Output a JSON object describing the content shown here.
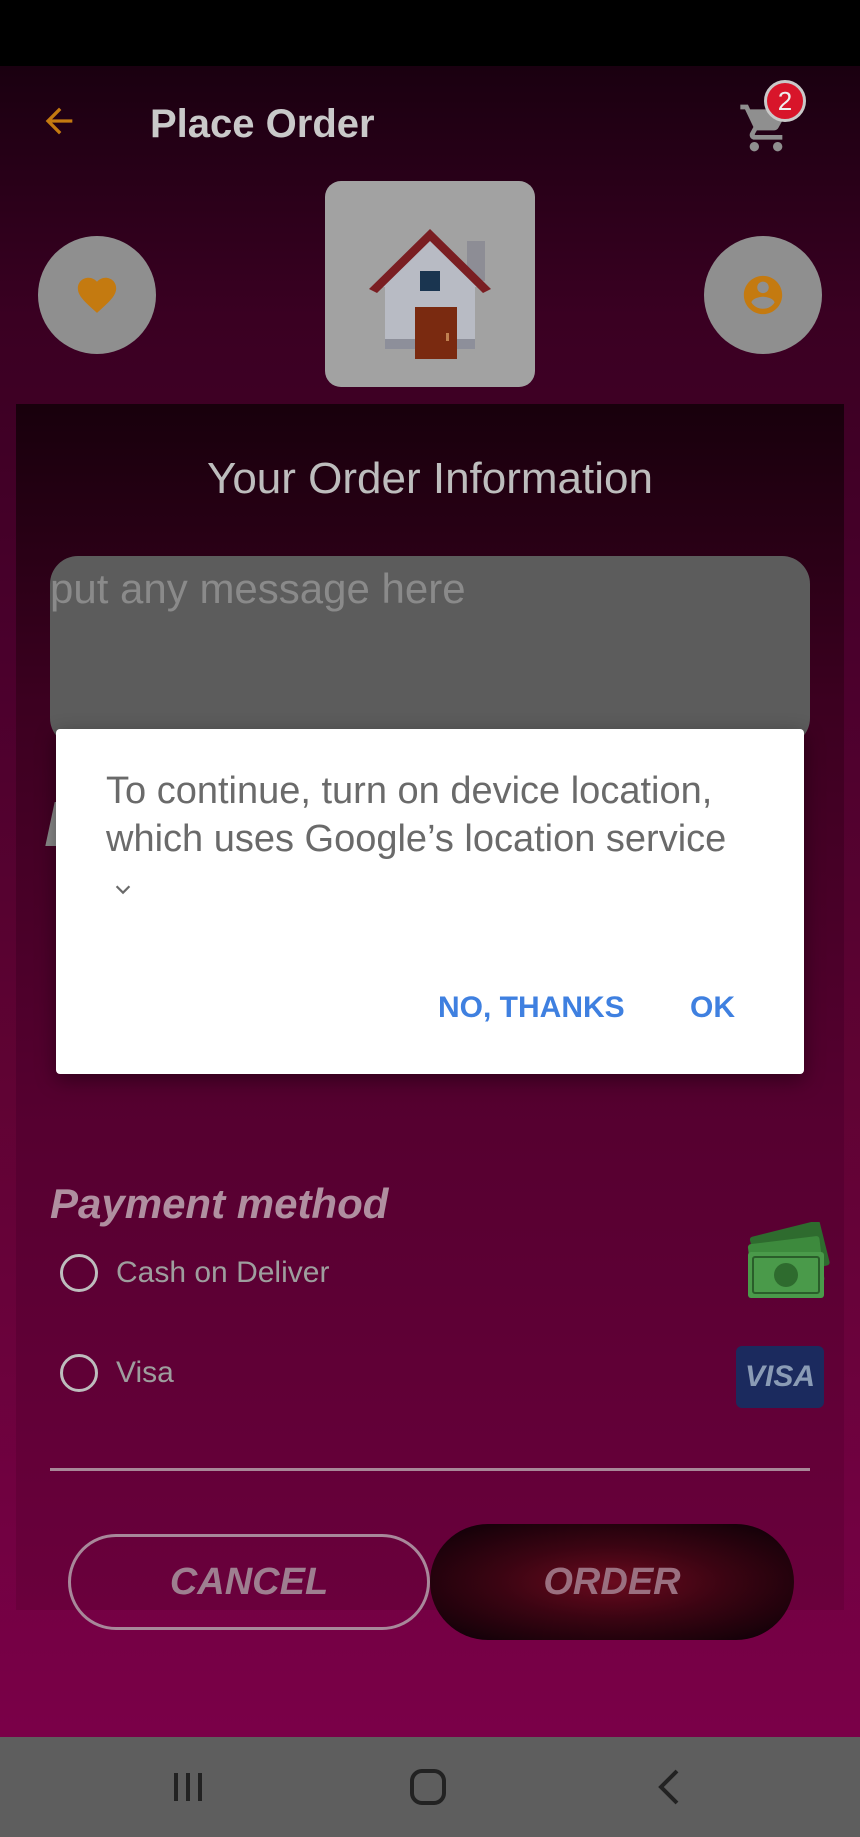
{
  "toolbar": {
    "title": "Place Order",
    "cart_count": "2"
  },
  "order": {
    "heading": "Your Order Information",
    "message_placeholder": "put any message here"
  },
  "payment": {
    "heading": "Payment method",
    "options": [
      {
        "label": "Cash on Deliver",
        "icon": "cash-icon",
        "selected": false
      },
      {
        "label": "Visa",
        "icon": "visa-card-icon",
        "selected": false
      }
    ],
    "visa_logo_text": "VISA"
  },
  "actions": {
    "cancel_label": "CANCEL",
    "order_label": "ORDER"
  },
  "dialog": {
    "message": "To continue, turn on device location, which uses Google’s location service",
    "negative_label": "NO, THANKS",
    "positive_label": "OK"
  },
  "navigation": {
    "items": [
      "recent-apps-icon",
      "home-icon",
      "back-icon"
    ]
  },
  "colors": {
    "accent": "#c47a10",
    "dialog_button": "#3f80e0",
    "background": "#5f0333"
  }
}
